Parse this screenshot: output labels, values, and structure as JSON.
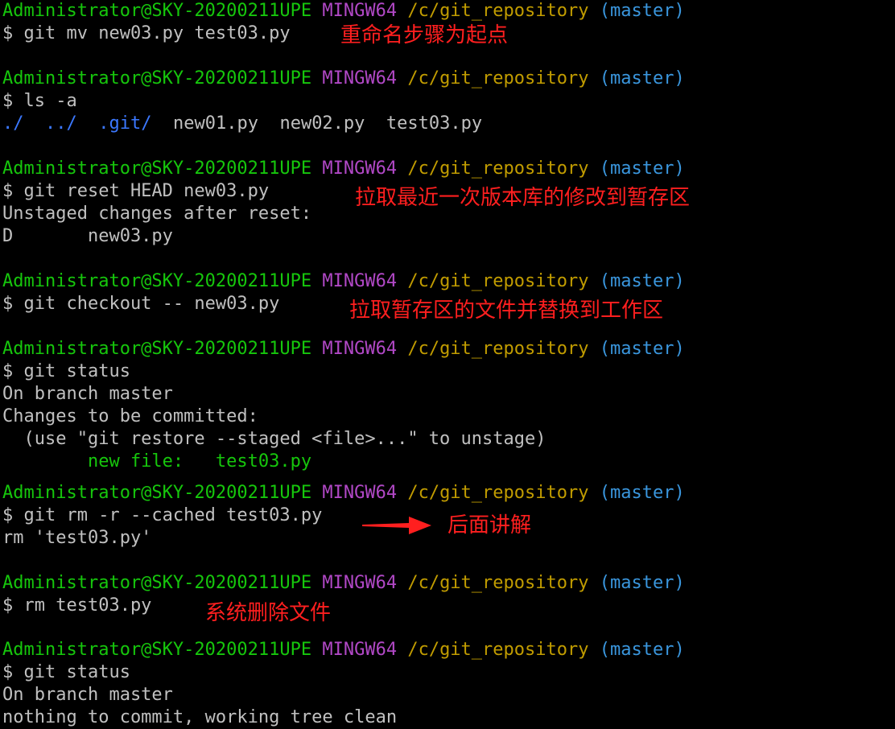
{
  "colors": {
    "background": "#000000",
    "text": "#c0c0c0",
    "user_host": "#16c60c",
    "mingw": "#b148c6",
    "path": "#c19c00",
    "branch": "#3a96dd",
    "directory": "#3b78ff",
    "staged_file": "#16c60c",
    "annotation": "#ff1f1f"
  },
  "prompt": {
    "user_host": "Administrator@SKY-20200211UPE",
    "mingw": "MINGW64",
    "path": "/c/git_repository",
    "branch": "(master)"
  },
  "blocks": [
    {
      "command": "$ git mv new03.py test03.py"
    },
    {
      "command": "$ ls -a",
      "ls_dirs": [
        "./",
        "../",
        ".git/"
      ],
      "ls_files": [
        "new01.py",
        "new02.py",
        "test03.py"
      ]
    },
    {
      "command": "$ git reset HEAD new03.py",
      "output": [
        "Unstaged changes after reset:",
        "D       new03.py"
      ]
    },
    {
      "command": "$ git checkout -- new03.py"
    },
    {
      "command": "$ git status",
      "output": [
        "On branch master",
        "Changes to be committed:",
        "  (use \"git restore --staged <file>...\" to unstage)"
      ],
      "staged": "        new file:   test03.py"
    },
    {
      "command": "$ git rm -r --cached test03.py",
      "output": [
        "rm 'test03.py'"
      ]
    },
    {
      "command": "$ rm test03.py"
    },
    {
      "command": "$ git status",
      "output": [
        "On branch master",
        "nothing to commit, working tree clean"
      ]
    }
  ],
  "annotations": {
    "rename_start": "重命名步骤为起点",
    "reset_head": "拉取最近一次版本库的修改到暂存区",
    "checkout": "拉取暂存区的文件并替换到工作区",
    "explain_later": "后面讲解",
    "system_delete": "系统删除文件"
  },
  "icons": {
    "arrow": "right-arrow-icon"
  }
}
